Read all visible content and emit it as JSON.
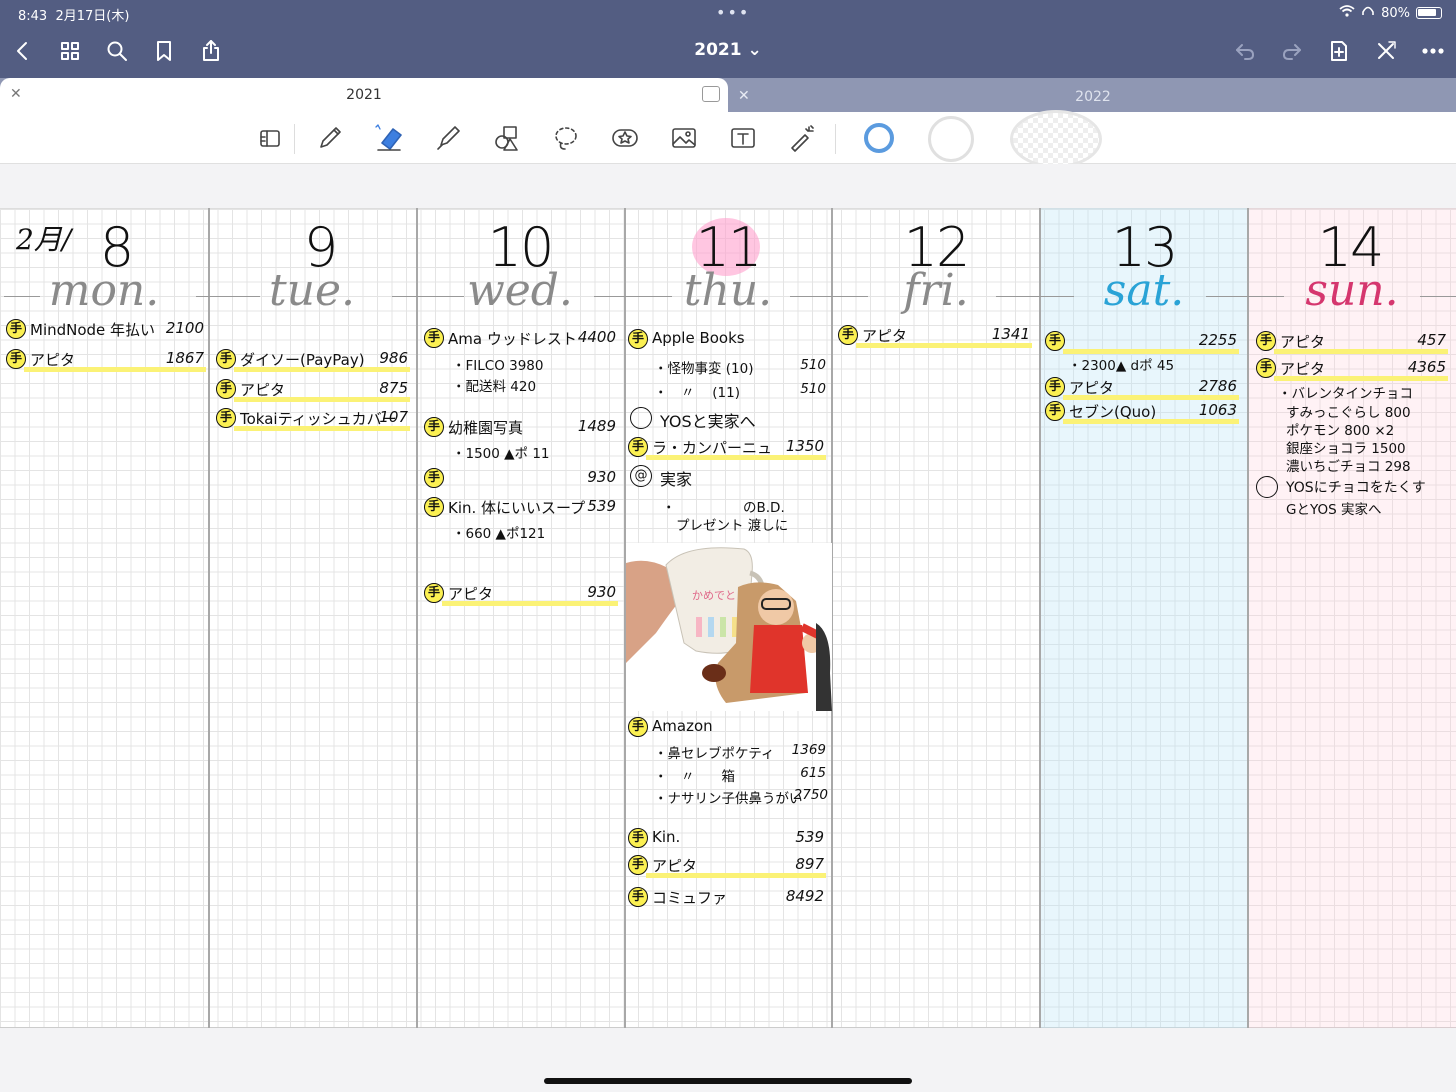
{
  "status_bar": {
    "time": "8:43",
    "date": "2月17日(木)",
    "battery": "80%"
  },
  "document": {
    "title": "2021 ⌄"
  },
  "tabs": [
    {
      "label": "2021",
      "active": true
    },
    {
      "label": "2022",
      "active": false
    }
  ],
  "icons": {
    "nav": [
      "back-icon",
      "grid-icon",
      "search-icon",
      "bookmark-icon",
      "share-icon"
    ],
    "actions": [
      "undo-icon",
      "redo-icon",
      "add-page-icon",
      "close-x-icon",
      "more-icon"
    ],
    "tools": [
      "page-layout-icon",
      "pen-icon",
      "eraser-icon",
      "highlighter-icon",
      "shapes-icon",
      "lasso-icon",
      "sticker-icon",
      "image-icon",
      "text-icon",
      "laser-icon"
    ]
  },
  "colors": {
    "topbar": "#535d82",
    "highlight": "#fbf276",
    "saturday": "#2aa3d6",
    "sunday": "#d5366e",
    "today": "#ffa0cd"
  },
  "planner": {
    "month": "2月/",
    "days": [
      {
        "num": "8",
        "weekday": "mon."
      },
      {
        "num": "9",
        "weekday": "tue."
      },
      {
        "num": "10",
        "weekday": "wed."
      },
      {
        "num": "11",
        "weekday": "thu."
      },
      {
        "num": "12",
        "weekday": "fri."
      },
      {
        "num": "13",
        "weekday": "sat."
      },
      {
        "num": "14",
        "weekday": "sun."
      }
    ],
    "mon": [
      {
        "label": "MindNode 年払い",
        "amount": "2100"
      },
      {
        "label": "アピタ",
        "amount": "1867"
      }
    ],
    "tue": [
      {
        "label": "ダイソー(PayPay)",
        "amount": "986"
      },
      {
        "label": "アピタ",
        "amount": "875"
      },
      {
        "label": "Tokaiティッシュカバー",
        "amount": "107"
      }
    ],
    "wed": [
      {
        "label": "Ama ウッドレスト",
        "amount": "4400"
      },
      {
        "label": "・FILCO 3980"
      },
      {
        "label": "・配送料 420"
      },
      {
        "label": "幼稚園写真",
        "amount": "1489"
      },
      {
        "label": "・1500 ▲ポ 11"
      },
      {
        "label": "",
        "amount": "930"
      },
      {
        "label": "Kin. 体にいいスープ",
        "amount": "539"
      },
      {
        "label": "・660 ▲ポ121"
      },
      {
        "label": "アピタ",
        "amount": "930"
      }
    ],
    "thu": [
      {
        "label": "Apple Books"
      },
      {
        "label": "・怪物事変 (10)",
        "amount": "510"
      },
      {
        "label": "・　〃　 (11)",
        "amount": "510"
      },
      {
        "label": "YOSと実家へ"
      },
      {
        "label": "ラ・カンパーニュ",
        "amount": "1350"
      },
      {
        "label": "実家"
      },
      {
        "label": "・　　　　　のB.D."
      },
      {
        "label": "プレゼント 渡しに"
      },
      {
        "label": "Amazon"
      },
      {
        "label": "・鼻セレブポケティ",
        "amount": "1369"
      },
      {
        "label": "・　〃　　箱",
        "amount": "615"
      },
      {
        "label": "・ナサリン子供鼻うがい",
        "amount": "2750"
      },
      {
        "label": "Kin.",
        "amount": "539"
      },
      {
        "label": "アピタ",
        "amount": "897"
      },
      {
        "label": "コミュファ",
        "amount": "8492"
      }
    ],
    "fri": [
      {
        "label": "アピタ",
        "amount": "1341"
      }
    ],
    "sat": [
      {
        "label": "",
        "amount": "2255"
      },
      {
        "label": "・2300▲ dポ 45"
      },
      {
        "label": "アピタ",
        "amount": "2786"
      },
      {
        "label": "セブン(Quo)",
        "amount": "1063"
      }
    ],
    "sun": [
      {
        "label": "アピタ",
        "amount": "457"
      },
      {
        "label": "アピタ",
        "amount": "4365"
      },
      {
        "label": "・バレンタインチョコ"
      },
      {
        "label": "すみっこぐらし 800"
      },
      {
        "label": "ポケモン 800 ×2"
      },
      {
        "label": "銀座ショコラ 1500"
      },
      {
        "label": "濃いちごチョコ 298"
      },
      {
        "label": "YOSにチョコをたくす"
      },
      {
        "label": "GとYOS 実家へ"
      }
    ]
  }
}
